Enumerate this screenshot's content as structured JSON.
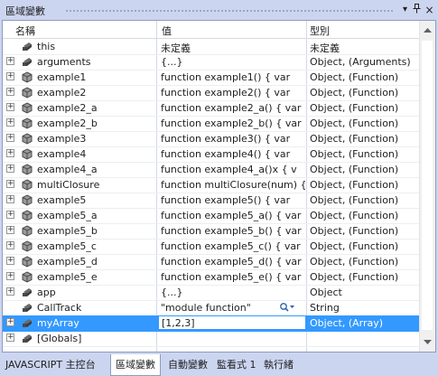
{
  "window": {
    "title": "區域變數"
  },
  "columns": {
    "name": "名稱",
    "value": "值",
    "type": "型別"
  },
  "rows": [
    {
      "name": "this",
      "value": "未定義",
      "type": "未定義",
      "expandable": false,
      "icon": "property-icon"
    },
    {
      "name": "arguments",
      "value": "{...}",
      "type": "Object, (Arguments)",
      "expandable": true,
      "icon": "property-icon"
    },
    {
      "name": "example1",
      "value": "function example1()   {     var",
      "type": "Object, (Function)",
      "expandable": true,
      "icon": "method-icon"
    },
    {
      "name": "example2",
      "value": "function example2()   {     var",
      "type": "Object, (Function)",
      "expandable": true,
      "icon": "method-icon"
    },
    {
      "name": "example2_a",
      "value": "function example2_a()   {     var",
      "type": "Object, (Function)",
      "expandable": true,
      "icon": "method-icon"
    },
    {
      "name": "example2_b",
      "value": "function example2_b()   {     var",
      "type": "Object, (Function)",
      "expandable": true,
      "icon": "method-icon"
    },
    {
      "name": "example3",
      "value": "function example3()   {     var",
      "type": "Object, (Function)",
      "expandable": true,
      "icon": "method-icon"
    },
    {
      "name": "example4",
      "value": "function example4()   {     var",
      "type": "Object, (Function)",
      "expandable": true,
      "icon": "method-icon"
    },
    {
      "name": "example4_a",
      "value": "function example4_a()x   {     v",
      "type": "Object, (Function)",
      "expandable": true,
      "icon": "method-icon"
    },
    {
      "name": "multiClosure",
      "value": "function multiClosure(num) {",
      "type": "Object, (Function)",
      "expandable": true,
      "icon": "method-icon"
    },
    {
      "name": "example5",
      "value": "function example5()   {     var",
      "type": "Object, (Function)",
      "expandable": true,
      "icon": "method-icon"
    },
    {
      "name": "example5_a",
      "value": "function example5_a()   {     var",
      "type": "Object, (Function)",
      "expandable": true,
      "icon": "method-icon"
    },
    {
      "name": "example5_b",
      "value": "function example5_b()   {     var",
      "type": "Object, (Function)",
      "expandable": true,
      "icon": "method-icon"
    },
    {
      "name": "example5_c",
      "value": "function example5_c()   {     var",
      "type": "Object, (Function)",
      "expandable": true,
      "icon": "method-icon"
    },
    {
      "name": "example5_d",
      "value": "function example5_d()   {     var",
      "type": "Object, (Function)",
      "expandable": true,
      "icon": "method-icon"
    },
    {
      "name": "example5_e",
      "value": "function example5_e()   {     var",
      "type": "Object, (Function)",
      "expandable": true,
      "icon": "method-icon"
    },
    {
      "name": "app",
      "value": "{...}",
      "type": "Object",
      "expandable": true,
      "icon": "property-icon"
    },
    {
      "name": "CallTrack",
      "value": "\"module function\"",
      "type": "String",
      "expandable": false,
      "icon": "property-icon"
    },
    {
      "name": "myArray",
      "value": "[1,2,3]",
      "type": "Object, (Array)",
      "expandable": true,
      "icon": "property-icon",
      "selected": true
    },
    {
      "name": "[Globals]",
      "value": "",
      "type": "",
      "expandable": true,
      "icon": "property-icon"
    }
  ],
  "tabs": [
    {
      "label": "JAVASCRIPT 主控台",
      "active": false
    },
    {
      "label": "區域變數",
      "active": true
    },
    {
      "label": "自動變數",
      "active": false
    },
    {
      "label": "監看式 1",
      "active": false
    },
    {
      "label": "執行緒",
      "active": false
    }
  ],
  "colors": {
    "selection": "#3399ff",
    "chrome": "#ccd5f0",
    "border": "#8e9bbc"
  }
}
